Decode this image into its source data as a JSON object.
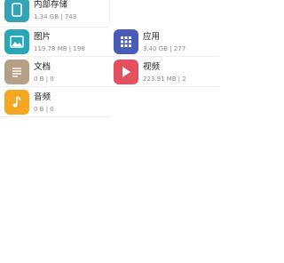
{
  "categories": [
    {
      "id": "internal-storage",
      "title": "内部存储",
      "meta": "1.34 GB | 743",
      "icon": "phone-icon",
      "color": "#34a3b7"
    },
    {
      "id": "images",
      "title": "图片",
      "meta": "119.78 MB | 198",
      "icon": "image-icon",
      "color": "#2aa7b6"
    },
    {
      "id": "apps",
      "title": "应用",
      "meta": "3.40 GB | 277",
      "icon": "app-grid-icon",
      "color": "#4a5cba"
    },
    {
      "id": "documents",
      "title": "文档",
      "meta": "0 B | 0",
      "icon": "document-icon",
      "color": "#b59f86"
    },
    {
      "id": "videos",
      "title": "视频",
      "meta": "223.91 MB | 2",
      "icon": "play-icon",
      "color": "#e5505e"
    },
    {
      "id": "audio",
      "title": "音频",
      "meta": "0 B | 0",
      "icon": "music-note-icon",
      "color": "#f5a623"
    }
  ]
}
